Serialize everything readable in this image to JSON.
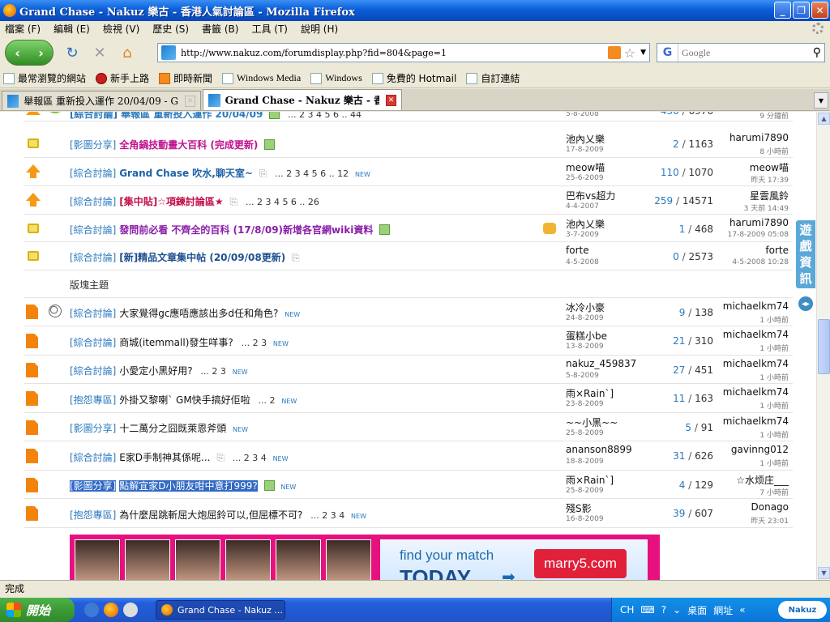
{
  "window": {
    "title": "Grand Chase - Nakuz 樂古 - 香港人氣討論區 - Mozilla Firefox"
  },
  "menu": [
    "檔案 (F)",
    "編輯 (E)",
    "檢視 (V)",
    "歷史 (S)",
    "書籤 (B)",
    "工具 (T)",
    "說明 (H)"
  ],
  "nav": {
    "url": "http://www.nakuz.com/forumdisplay.php?fid=804&page=1",
    "search_placeholder": "Google"
  },
  "bookmarks": [
    "最常瀏覽的網站",
    "新手上路",
    "即時新聞",
    "Windows Media",
    "Windows",
    "免費的 Hotmail",
    "自訂連結"
  ],
  "tabs": [
    {
      "label": "舉報區 重新投入運作 20/04/09 - Gra...",
      "active": false
    },
    {
      "label": "Grand Chase - Nakuz 樂古 - 香...",
      "active": true
    }
  ],
  "forum": {
    "partial_row": {
      "title": "[綜合討論] 舉報區 重新投入運作 20/04/09",
      "pages": "... 2 3 4 5 6 .. 44",
      "date": "5-8-2008",
      "replies": "430",
      "views": "6976",
      "last_time": "9 分鐘前"
    },
    "pinned": [
      {
        "cat": "[影圖分享]",
        "title": "全角鍋技動畫大百科 (完成更新)",
        "pages": "",
        "author": "池內乂樂",
        "date": "17-8-2009",
        "replies": "2",
        "views": "1163",
        "last_by": "harumi7890",
        "last_time": "8 小時前"
      },
      {
        "cat": "[綜合討論]",
        "title": "Grand Chase 吹水,聊天室~",
        "pages": "... 2 3 4 5 6 .. 12",
        "new": "NEW",
        "author": "meow喵",
        "date": "25-6-2009",
        "replies": "110",
        "views": "1070",
        "last_by": "meow喵",
        "last_time": "昨天 17:39"
      },
      {
        "cat": "[綜合討論]",
        "title": "[集中貼]☆項鍊討論區★",
        "pages": "... 2 3 4 5 6 .. 26",
        "author": "巴布vs超力",
        "date": "4-4-2007",
        "replies": "259",
        "views": "14571",
        "last_by": "星雲風鈴",
        "last_time": "3 天前 14:49"
      },
      {
        "cat": "[綜合討論]",
        "title": "發問前必看 不齊全的百科 (17/8/09)新增各官網wiki資料",
        "pages": "",
        "author": "池內乂樂",
        "date": "3-7-2009",
        "replies": "1",
        "views": "468",
        "last_by": "harumi7890",
        "last_time": "17-8-2009 05:08"
      },
      {
        "cat": "[綜合討論]",
        "title": "[新]精品文章集中帖 (20/09/08更新)",
        "pages": "",
        "author": "forte",
        "date": "4-5-2008",
        "replies": "0",
        "views": "2573",
        "last_by": "forte",
        "last_time": "4-5-2008 10:28"
      }
    ],
    "section_title": "版塊主題",
    "threads": [
      {
        "cat": "[綜合討論]",
        "title": "大家覺得gc應唔應該出多d任和角色?",
        "pages": "",
        "new": "NEW",
        "author": "冰冷小豪",
        "date": "24-8-2009",
        "replies": "9",
        "views": "138",
        "last_by": "michaelkm74",
        "last_time": "1 小時前"
      },
      {
        "cat": "[綜合討論]",
        "title": "商城(itemmall)發生咩事?",
        "pages": "... 2 3",
        "new": "NEW",
        "author": "蛋糕小be",
        "date": "13-8-2009",
        "replies": "21",
        "views": "310",
        "last_by": "michaelkm74",
        "last_time": "1 小時前"
      },
      {
        "cat": "[綜合討論]",
        "title": "小愛定小黑好用?",
        "pages": "... 2 3",
        "new": "NEW",
        "author": "nakuz_459837",
        "date": "5-8-2009",
        "replies": "27",
        "views": "451",
        "last_by": "michaelkm74",
        "last_time": "1 小時前"
      },
      {
        "cat": "[抱怨專區]",
        "title": "外掛又黎喇` GM快手搞好佢啦",
        "pages": "... 2",
        "new": "NEW",
        "author": "雨×Rain`]",
        "date": "23-8-2009",
        "replies": "11",
        "views": "163",
        "last_by": "michaelkm74",
        "last_time": "1 小時前"
      },
      {
        "cat": "[影圖分享]",
        "title": "十二萬分之囧既萊恩斧頭",
        "pages": "",
        "new": "NEW",
        "author": "~~小黑~~",
        "date": "25-8-2009",
        "replies": "5",
        "views": "91",
        "last_by": "michaelkm74",
        "last_time": "1 小時前"
      },
      {
        "cat": "[綜合討論]",
        "title": "E家D手制神其係呢...",
        "pages": "... 2 3 4",
        "new": "NEW",
        "author": "ananson8899",
        "date": "18-8-2009",
        "replies": "31",
        "views": "626",
        "last_by": "gavinng012",
        "last_time": "1 小時前"
      },
      {
        "cat": "[影圖分享]",
        "title": "點解宜家D小朋友咁中意打999?",
        "pages": "",
        "new": "NEW",
        "author": "雨×Rain`]",
        "date": "25-8-2009",
        "replies": "4",
        "views": "129",
        "last_by": "☆水烦庄___",
        "last_time": "7 小時前"
      },
      {
        "cat": "[抱怨專區]",
        "title": "為什麼屈跳斬屈大炮屈鈴可以,但屈標不可?",
        "pages": "... 2 3 4",
        "new": "NEW",
        "author": "殘S影",
        "date": "16-8-2009",
        "replies": "39",
        "views": "607",
        "last_by": "Donago",
        "last_time": "昨天 23:01"
      }
    ],
    "side_tab": "遊戲資訊"
  },
  "ad": {
    "line1": "find your match",
    "line2": "TODAY",
    "brand": "marry5.com"
  },
  "status": "完成",
  "taskbar": {
    "start": "開始",
    "task": "Grand Chase - Nakuz ...",
    "lang": "CH",
    "desktop": "桌面",
    "network": "網址",
    "logo": "Nakuz"
  }
}
